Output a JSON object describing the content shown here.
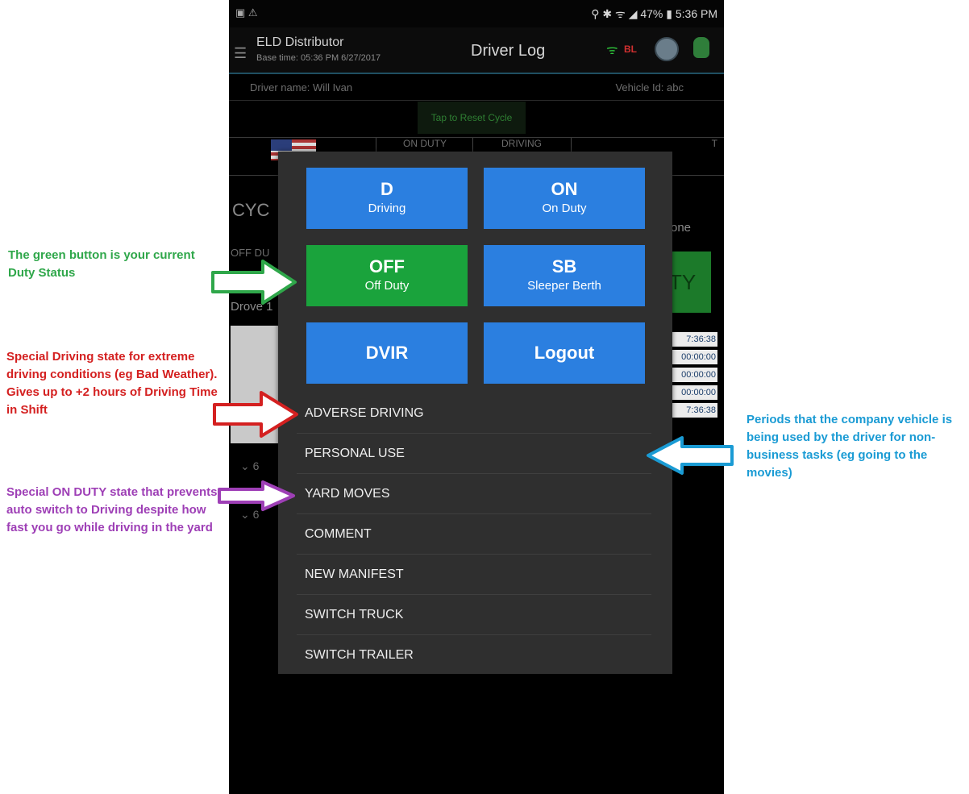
{
  "status_bar": {
    "left_icons": "▣ ⚠",
    "right_text": "⚲ ✱ ᯤ ◢ 47% ▮ 5:36 PM"
  },
  "app_bar": {
    "app_name": "ELD Distributor",
    "base_time": "Base time: 05:36 PM 6/27/2017",
    "screen_title": "Driver Log",
    "bluetooth_label": "BL"
  },
  "driver_row": {
    "driver_name": "Driver name: Will Ivan",
    "vehicle_id": "Vehicle Id: abc"
  },
  "reset_cycle_label": "Tap to Reset Cycle",
  "status_columns": [
    "ON DUTY",
    "DRIVING",
    "T"
  ],
  "background_fragments": {
    "cycle": "CYC",
    "off": "OFF DU",
    "drove": "Drove 1",
    "one": "one",
    "ty": "TY",
    "log_row_1": "6",
    "log_row_2": "6"
  },
  "totals": [
    "7:36:38",
    "00:00:00",
    "00:00:00",
    "00:00:00",
    "7:36:38"
  ],
  "dialog": {
    "status_buttons": [
      {
        "code": "D",
        "label": "Driving",
        "active": false
      },
      {
        "code": "ON",
        "label": "On Duty",
        "active": false
      },
      {
        "code": "OFF",
        "label": "Off Duty",
        "active": true
      },
      {
        "code": "SB",
        "label": "Sleeper Berth",
        "active": false
      }
    ],
    "action_buttons": [
      {
        "label": "DVIR"
      },
      {
        "label": "Logout"
      }
    ],
    "menu_items": [
      "ADVERSE DRIVING",
      "PERSONAL USE",
      "YARD MOVES",
      "COMMENT",
      "NEW MANIFEST",
      "SWITCH TRUCK",
      "SWITCH TRAILER"
    ]
  },
  "annotations": {
    "green_note": "The green button is your current Duty Status",
    "red_note": "Special Driving state for extreme driving conditions (eg Bad Weather). Gives up to +2 hours of Driving Time in Shift",
    "purple_note": "Special ON DUTY state that prevents auto switch to Driving despite how fast you go while driving in the yard",
    "blue_note": "Periods that the company vehicle is being used by the driver for non-business tasks (eg going to the movies)"
  },
  "colors": {
    "active_status": "#1aa33c",
    "status_button": "#2b7fe0",
    "dialog_background": "#2f2f2f",
    "green_note": "#2fa74a",
    "red_note": "#d42020",
    "purple_note": "#9e3fb6",
    "blue_note": "#1a9bd4"
  }
}
